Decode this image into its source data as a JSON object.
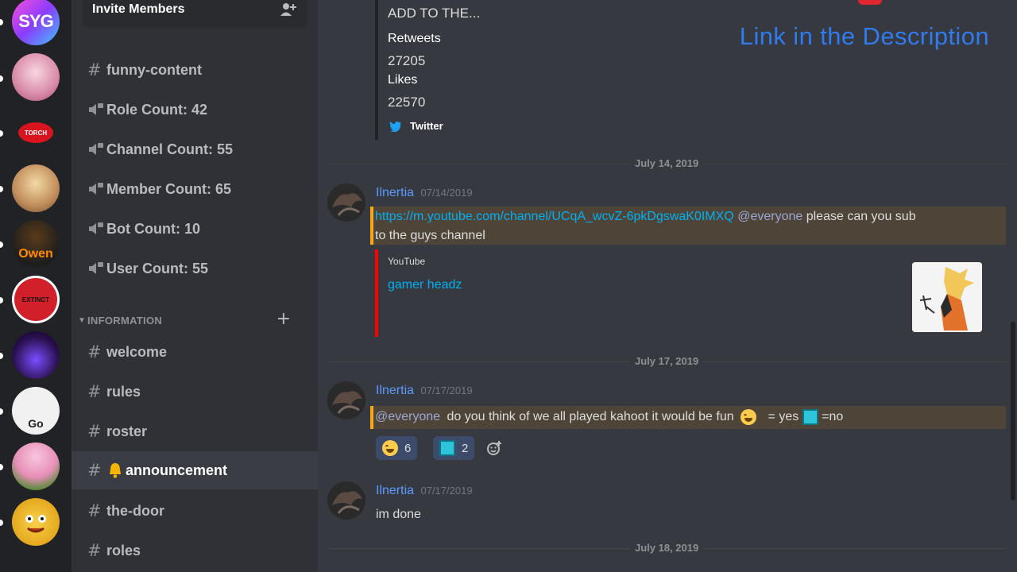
{
  "sidebar": {
    "invite_label": "Invite Members",
    "channels": [
      {
        "label": "funny-content"
      },
      {
        "label": "Role Count: 42"
      },
      {
        "label": "Channel Count: 55"
      },
      {
        "label": "Member Count: 65"
      },
      {
        "label": "Bot Count: 10"
      },
      {
        "label": "User Count: 55"
      },
      {
        "label": "welcome"
      },
      {
        "label": "rules"
      },
      {
        "label": "roster"
      },
      {
        "label": "announcement"
      },
      {
        "label": "the-door"
      },
      {
        "label": "roles"
      }
    ],
    "category": "INFORMATION",
    "hash": "#",
    "plus": "+"
  },
  "servers": [
    {
      "label": "SYG"
    },
    {
      "label": ""
    },
    {
      "label": "TORCH"
    },
    {
      "label": ""
    },
    {
      "label": "Owen"
    },
    {
      "label": "EXTINCT"
    },
    {
      "label": ""
    },
    {
      "label": "Go"
    },
    {
      "label": ""
    },
    {
      "label": ""
    }
  ],
  "watermark": "Link in the Description",
  "embed_top": {
    "title": "ADD TO THE...",
    "retweets_label": "Retweets",
    "retweets_value": "27205",
    "likes_label": "Likes",
    "likes_value": "22570",
    "footer": "Twitter"
  },
  "dates": [
    "July 14, 2019",
    "July 17, 2019",
    "July 18, 2019"
  ],
  "messages": [
    {
      "author": "Ilnertia",
      "timestamp": "07/14/2019",
      "link": "https://m.youtube.com/channel/UCqA_wcvZ-6pkDgswaK0IMXQ",
      "mention": "@everyone",
      "text": "please can you sub",
      "text2": "to the guys channel",
      "embed_provider": "YouTube",
      "embed_title": "gamer headz"
    },
    {
      "author": "Ilnertia",
      "timestamp": "07/17/2019",
      "mention": "@everyone",
      "text": "do you think of we all played kahoot it would be fun",
      "yes": "= yes",
      "no": "=no",
      "reactions": [
        {
          "count": "6"
        },
        {
          "count": "2"
        }
      ]
    },
    {
      "author": "Ilnertia",
      "timestamp": "07/17/2019",
      "text": "im done"
    }
  ],
  "colors": {
    "accent": "#5b9bff",
    "mention_bg": "#4e4538",
    "link": "#00b0f4",
    "watermark": "#2f7bef"
  },
  "icons": [
    "add-member-icon",
    "speaker-icon",
    "twitter-icon",
    "add-reaction-icon",
    "laugh-emoji-icon",
    "custom-emoji-icon"
  ]
}
